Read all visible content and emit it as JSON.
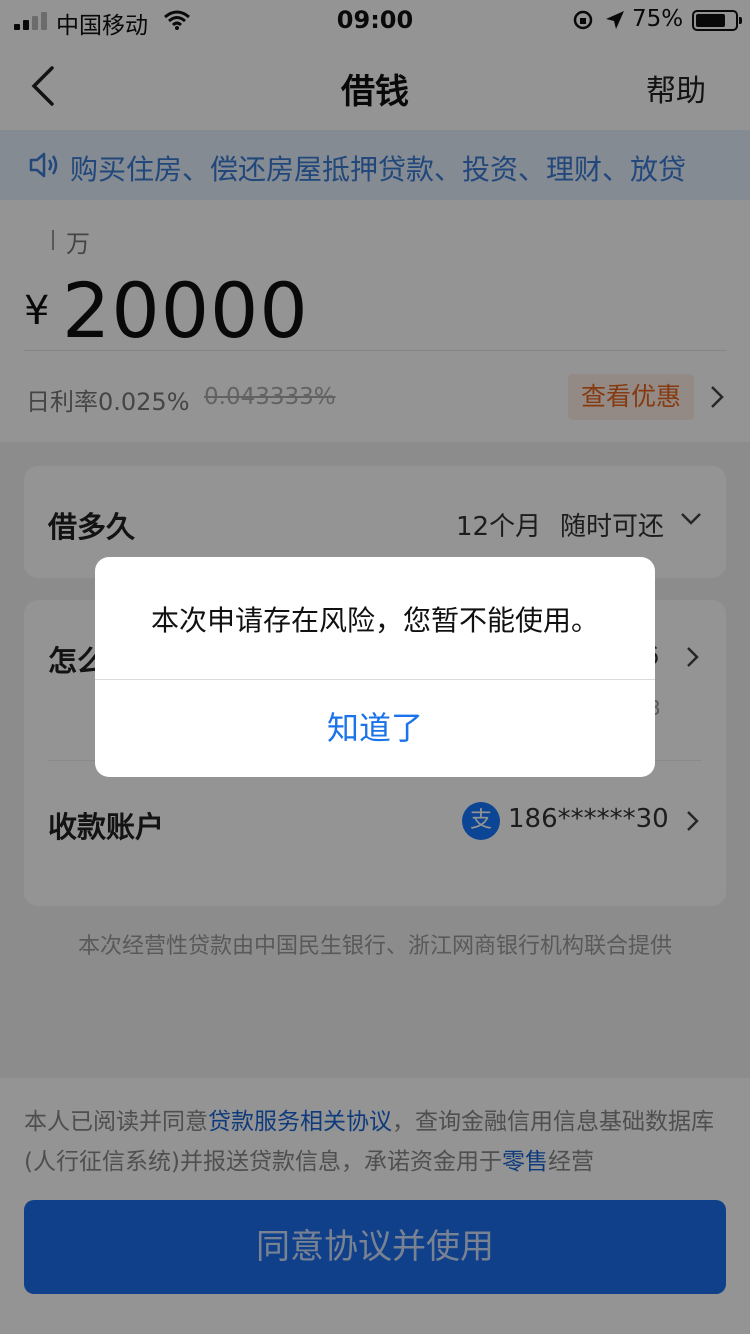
{
  "status_bar": {
    "carrier": "中国移动",
    "time": "09:00",
    "battery_pct": "75%",
    "battery_level": 0.75,
    "icons": [
      "signal-icon",
      "wifi-icon",
      "orientation-lock-icon",
      "location-icon",
      "battery-icon"
    ]
  },
  "nav": {
    "title": "借钱",
    "help": "帮助"
  },
  "notice": {
    "text": "购买住房、偿还房屋抵押贷款、投资、理财、放贷"
  },
  "amount": {
    "unit": "万",
    "currency": "¥",
    "value": "20000",
    "rate": "日利率0.025%",
    "rate_old": "0.043333%",
    "promo": "查看优惠"
  },
  "term": {
    "label": "借多久",
    "value": "12个月",
    "repay": "随时可还"
  },
  "howto": {
    "label": "怎么",
    "value": "6",
    "sub": "3"
  },
  "account": {
    "label": "收款账户",
    "icon_char": "支",
    "value": "186******30"
  },
  "provider_text": "本次经营性贷款由中国民生银行、浙江网商银行机构联合提供",
  "agreement": {
    "prefix": "本人已阅读并同意",
    "link1": "贷款服务相关协议",
    "middle": "，查询金融信用信息基础数据库(人行征信系统)并报送贷款信息，承诺资金用于",
    "link2": "零售",
    "suffix": "经营"
  },
  "submit_label": "同意协议并使用",
  "dialog": {
    "message": "本次申请存在风险，您暂不能使用。",
    "button": "知道了"
  },
  "colors": {
    "accent": "#1a73e8",
    "primary_button": "#1d6fee",
    "promo": "#e8641b",
    "notice_text": "#3a7bd5"
  }
}
